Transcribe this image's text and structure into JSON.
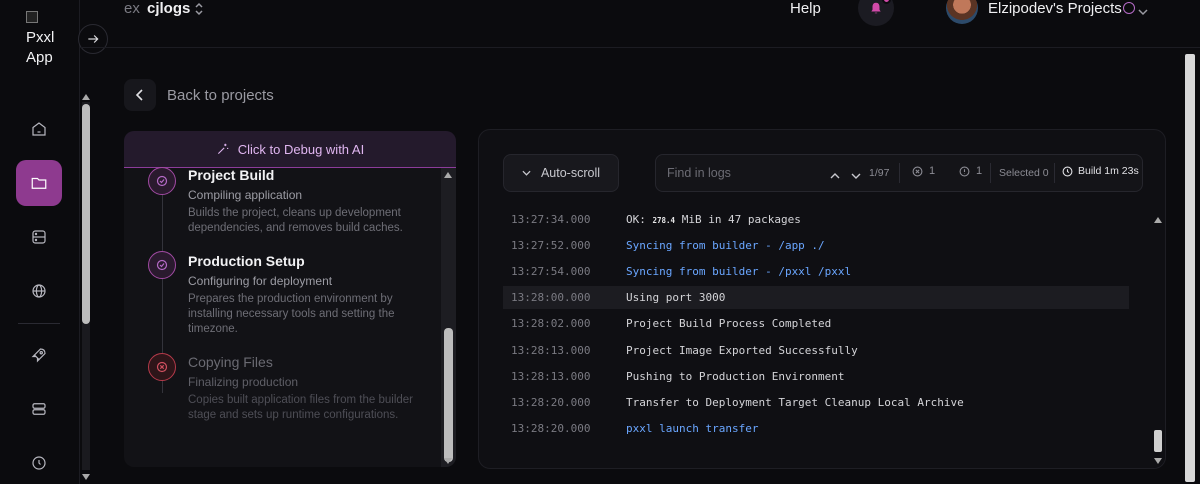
{
  "sidebar": {
    "logo_text": "Pxxl App",
    "nav": [
      {
        "icon": "home-icon",
        "active": false
      },
      {
        "icon": "folder-icon",
        "active": true
      },
      {
        "icon": "database-icon",
        "active": false
      },
      {
        "icon": "globe-icon",
        "active": false
      },
      {
        "icon": "rocket-icon",
        "active": false
      },
      {
        "icon": "server-icon",
        "active": false
      },
      {
        "icon": "clock-icon",
        "active": false
      }
    ]
  },
  "topbar": {
    "project_prefix": "ex",
    "project_name": "cjlogs",
    "help_label": "Help",
    "team_name": "Elzipodev's Projects"
  },
  "back": {
    "label": "Back to projects"
  },
  "steps": {
    "debug_label": "Click to Debug with AI",
    "items": [
      {
        "title": "Project Build",
        "subtitle": "Compiling application",
        "description": "Builds the project, cleans up development dependencies, and removes build caches.",
        "status": "done"
      },
      {
        "title": "Production Setup",
        "subtitle": "Configuring for deployment",
        "description": "Prepares the production environment by installing necessary tools and setting the timezone.",
        "status": "done"
      },
      {
        "title": "Copying Files",
        "subtitle": "Finalizing production",
        "description": "Copies built application files from the builder stage and sets up runtime configurations.",
        "status": "failed"
      }
    ]
  },
  "logs": {
    "autoscroll_label": "Auto-scroll",
    "search_placeholder": "Find in logs",
    "match_count": "1/97",
    "error_count": "1",
    "warning_count": "1",
    "selected_label": "Selected 0",
    "build_time_label": "Build 1m 23s",
    "rows": [
      {
        "time": "13:27:34.000",
        "prefix": "OK: ",
        "size": "278.4",
        "message": " MiB in 47 packages",
        "style": "normal"
      },
      {
        "time": "13:27:52.000",
        "message": "Syncing from builder - /app ./",
        "style": "blue"
      },
      {
        "time": "13:27:54.000",
        "message": "Syncing from builder - /pxxl /pxxl",
        "style": "blue"
      },
      {
        "time": "13:28:00.000",
        "message": "Using port 3000",
        "style": "highlight"
      },
      {
        "time": "13:28:02.000",
        "message": "Project Build Process Completed",
        "style": "normal"
      },
      {
        "time": "13:28:13.000",
        "message": "Project Image Exported Successfully",
        "style": "normal"
      },
      {
        "time": "13:28:13.000",
        "message": "Pushing to Production Environment",
        "style": "normal"
      },
      {
        "time": "13:28:20.000",
        "message": "Transfer to Deployment Target Cleanup Local Archive",
        "style": "normal"
      },
      {
        "time": "13:28:20.000",
        "message": "pxxl launch transfer",
        "style": "blue"
      }
    ]
  },
  "colors": {
    "accent": "#8e3a8f",
    "log_blue": "#6aa6ff",
    "fail_red": "#b53a4a"
  }
}
